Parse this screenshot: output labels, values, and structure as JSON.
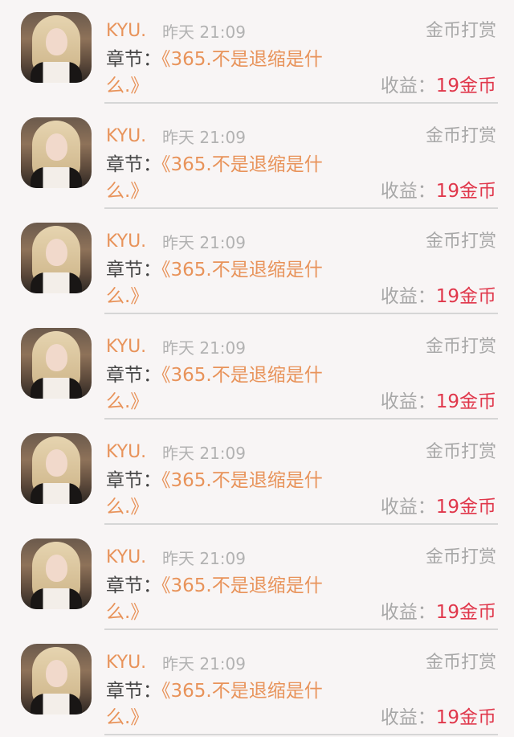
{
  "colors": {
    "background": "#f8f5f5",
    "accent_orange": "#e8935a",
    "coin_red": "#e0374b",
    "muted_gray": "#a8a8a8",
    "divider": "#d6d6d6"
  },
  "notifications": [
    {
      "user": "KYU.",
      "time": "昨天 21:09",
      "action": "金币打赏",
      "chapter_label": "章节：",
      "chapter_title": "《365.不是退缩是什",
      "chapter_title_end": "么.》",
      "earnings_label": "收益：",
      "earnings_value": "19金币"
    },
    {
      "user": "KYU.",
      "time": "昨天 21:09",
      "action": "金币打赏",
      "chapter_label": "章节：",
      "chapter_title": "《365.不是退缩是什",
      "chapter_title_end": "么.》",
      "earnings_label": "收益：",
      "earnings_value": "19金币"
    },
    {
      "user": "KYU.",
      "time": "昨天 21:09",
      "action": "金币打赏",
      "chapter_label": "章节：",
      "chapter_title": "《365.不是退缩是什",
      "chapter_title_end": "么.》",
      "earnings_label": "收益：",
      "earnings_value": "19金币"
    },
    {
      "user": "KYU.",
      "time": "昨天 21:09",
      "action": "金币打赏",
      "chapter_label": "章节：",
      "chapter_title": "《365.不是退缩是什",
      "chapter_title_end": "么.》",
      "earnings_label": "收益：",
      "earnings_value": "19金币"
    },
    {
      "user": "KYU.",
      "time": "昨天 21:09",
      "action": "金币打赏",
      "chapter_label": "章节：",
      "chapter_title": "《365.不是退缩是什",
      "chapter_title_end": "么.》",
      "earnings_label": "收益：",
      "earnings_value": "19金币"
    },
    {
      "user": "KYU.",
      "time": "昨天 21:09",
      "action": "金币打赏",
      "chapter_label": "章节：",
      "chapter_title": "《365.不是退缩是什",
      "chapter_title_end": "么.》",
      "earnings_label": "收益：",
      "earnings_value": "19金币"
    },
    {
      "user": "KYU.",
      "time": "昨天 21:09",
      "action": "金币打赏",
      "chapter_label": "章节：",
      "chapter_title": "《365.不是退缩是什",
      "chapter_title_end": "么.》",
      "earnings_label": "收益：",
      "earnings_value": "19金币"
    }
  ]
}
